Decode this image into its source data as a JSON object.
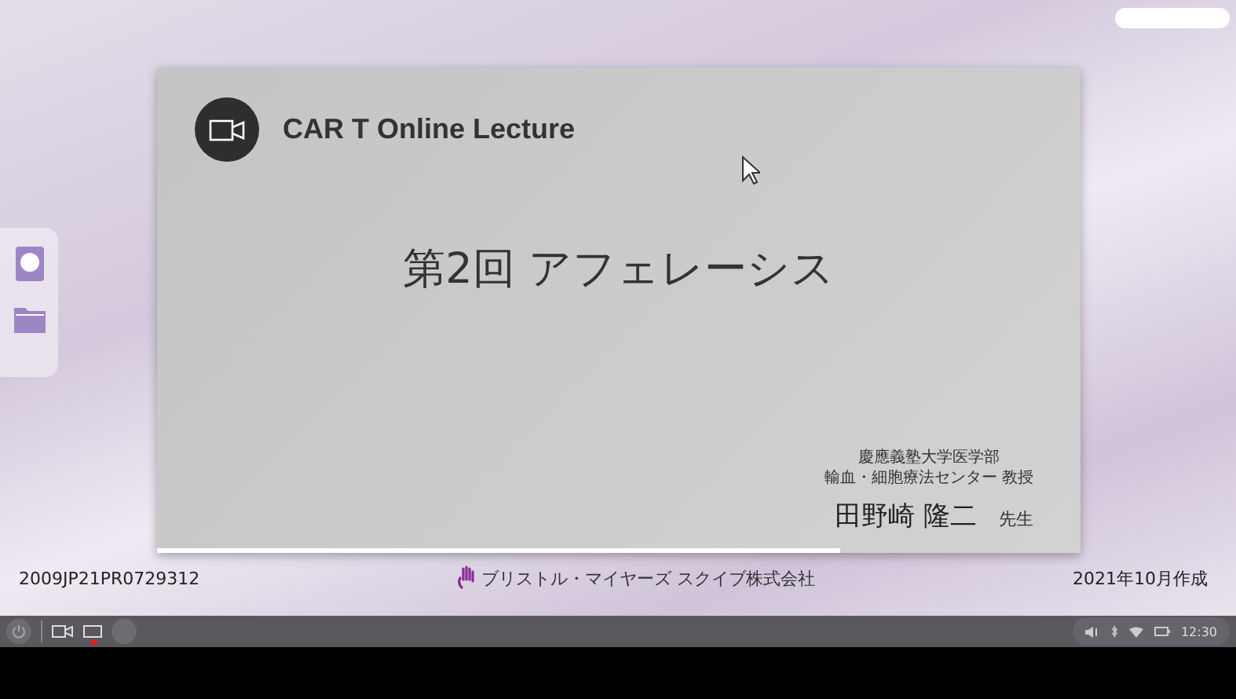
{
  "slide": {
    "title": "CAR T Online Lecture",
    "heading": "第2回 アフェレーシス",
    "affiliation": [
      "慶應義塾大学医学部",
      "輸血・細胞療法センター 教授"
    ],
    "speaker": "田野崎 隆二",
    "honorific": "先生",
    "progress": {
      "level": 0.74
    }
  },
  "footer": {
    "code": "2009JP21PR0729312",
    "company": "ブリストル・マイヤーズ スクイブ株式会社",
    "date": "2021年10月作成"
  },
  "taskbar": {
    "recording": true,
    "time": "12:30"
  }
}
